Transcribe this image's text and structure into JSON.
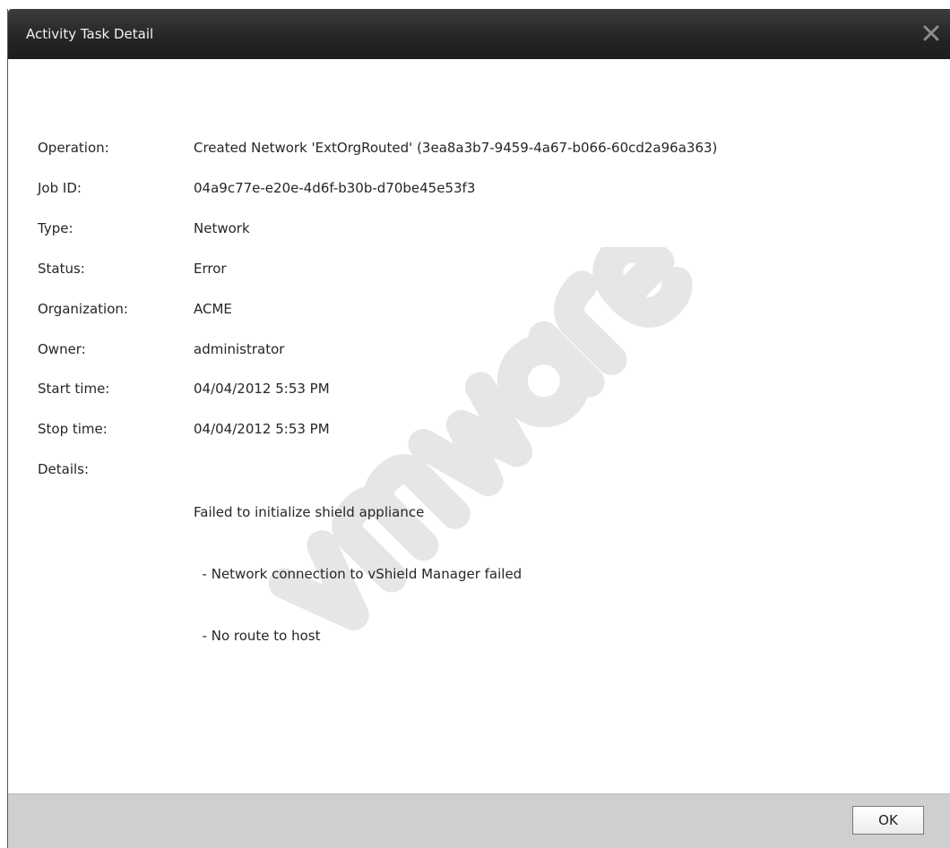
{
  "dialog": {
    "title": "Activity Task Detail",
    "close_icon": "close-icon"
  },
  "watermark": {
    "brand_icon": "vmware-logo"
  },
  "fields": [
    {
      "label": "Operation:",
      "value": "Created Network 'ExtOrgRouted' (3ea8a3b7-9459-4a67-b066-60cd2a96a363)"
    },
    {
      "label": "Job ID:",
      "value": "04a9c77e-e20e-4d6f-b30b-d70be45e53f3"
    },
    {
      "label": "Type:",
      "value": "Network"
    },
    {
      "label": "Status:",
      "value": "Error"
    },
    {
      "label": "Organization:",
      "value": "ACME"
    },
    {
      "label": "Owner:",
      "value": "administrator"
    },
    {
      "label": "Start time:",
      "value": "04/04/2012 5:53 PM"
    },
    {
      "label": "Stop time:",
      "value": "04/04/2012 5:53 PM"
    }
  ],
  "details": {
    "label": "Details:",
    "lines": [
      "Failed to initialize shield appliance",
      "  - Network connection to vShield Manager failed",
      "  - No route to host"
    ]
  },
  "footer": {
    "ok_label": "OK"
  },
  "colors": {
    "titlebar": "#262626",
    "title_text": "#f2f2f2",
    "body_text": "#262626",
    "footer": "#cfcfcf",
    "watermark": "#e6e6e6"
  }
}
